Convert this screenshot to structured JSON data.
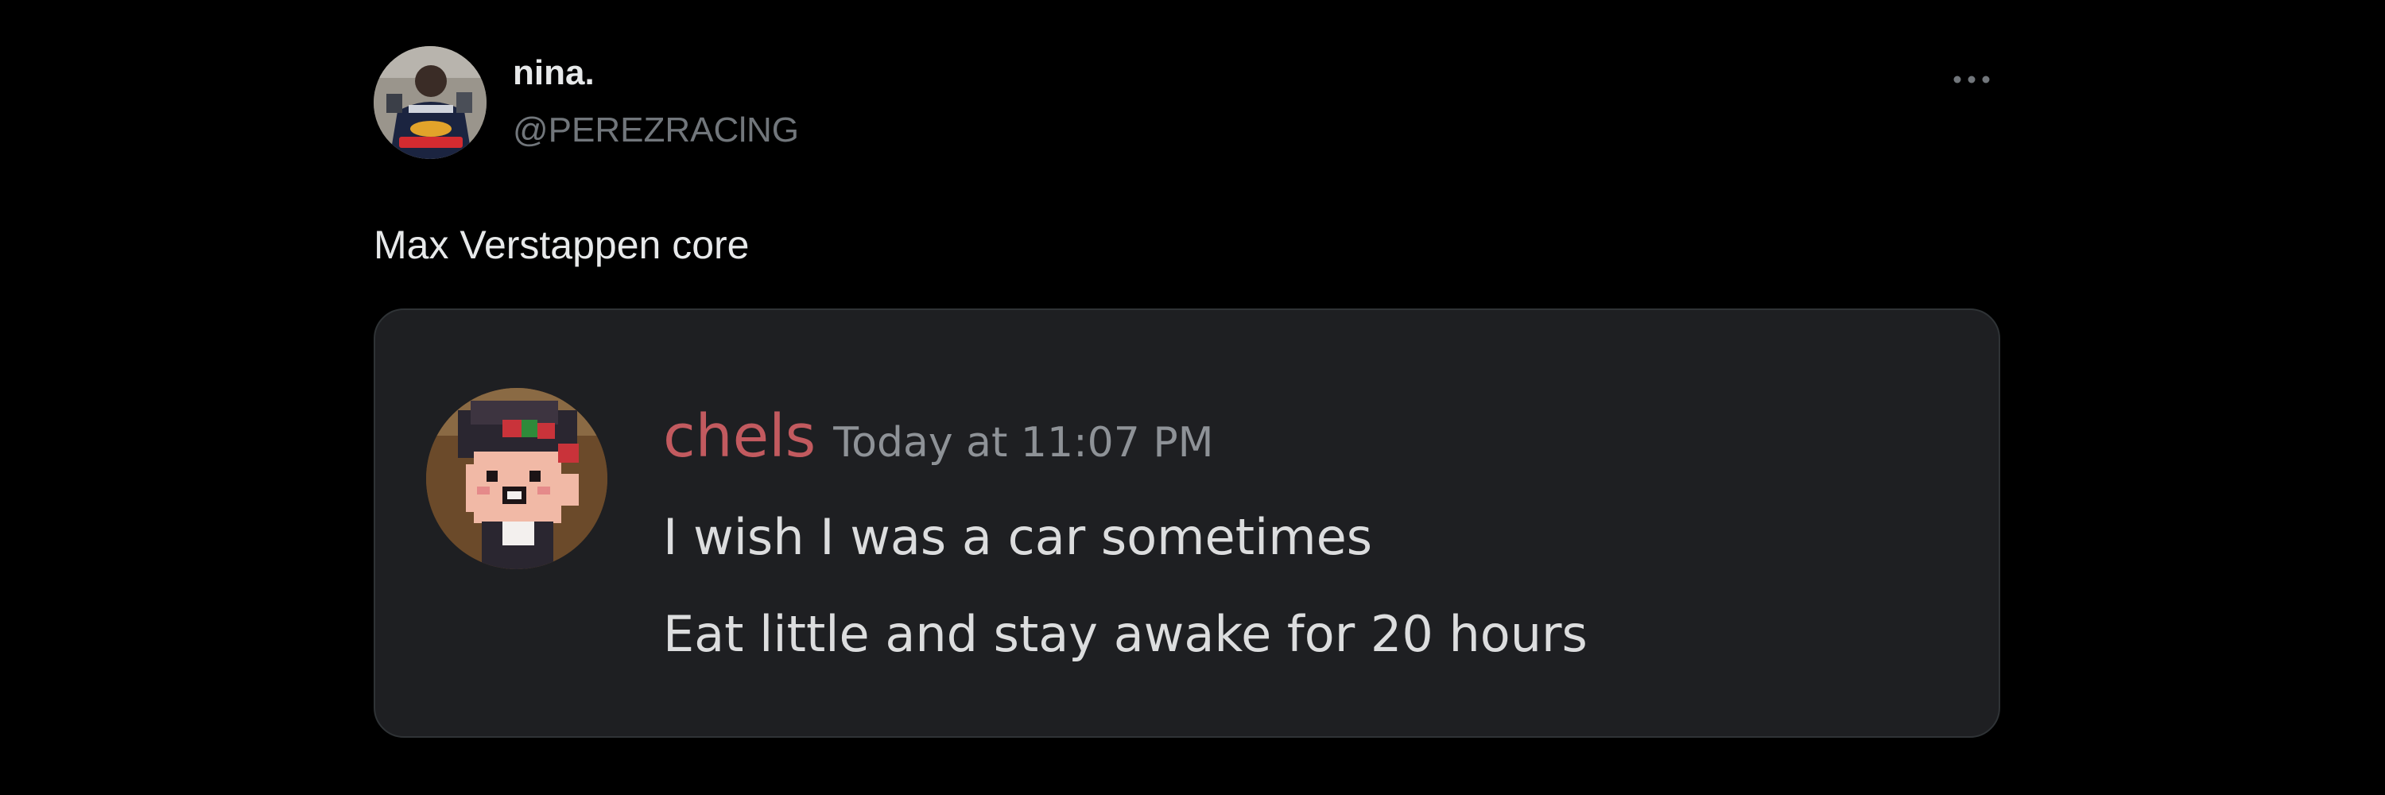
{
  "tweet": {
    "display_name": "nina.",
    "handle": "@PEREZRAClNG",
    "text": "Max Verstappen core",
    "more_icon": "more-horizontal-icon",
    "avatar_logo_text": "Red Bull"
  },
  "embedded_message": {
    "username": "chels",
    "timestamp": "Today at 11:07 PM",
    "lines": [
      "I wish I was a car sometimes",
      "Eat little and stay awake for 20 hours"
    ]
  },
  "colors": {
    "background": "#000000",
    "embed_background": "#1e1f22",
    "username": "#c25a5f",
    "muted": "#71767b"
  }
}
